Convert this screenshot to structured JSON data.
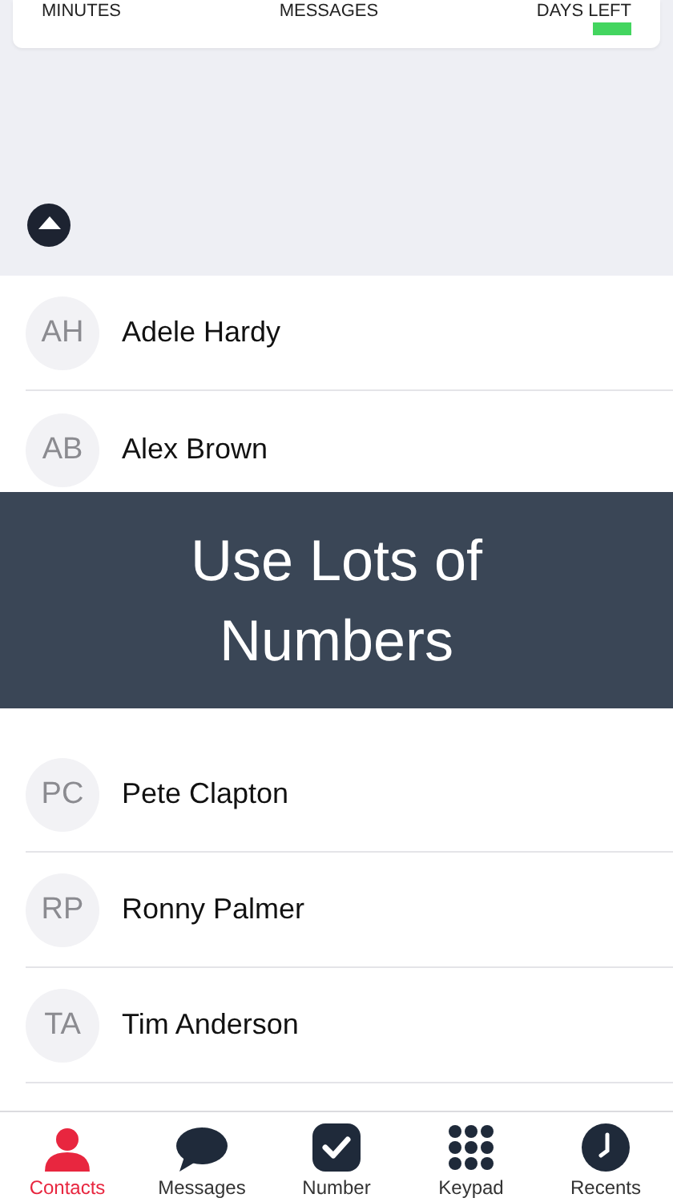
{
  "stats": [
    {
      "label": "MINUTES"
    },
    {
      "label": "MESSAGES"
    },
    {
      "label": "DAYS LEFT",
      "level": 1
    }
  ],
  "contacts": [
    {
      "initials": "AH",
      "name": "Adele Hardy"
    },
    {
      "initials": "AB",
      "name": "Alex Brown"
    },
    {
      "initials": "PC",
      "name": "Pete Clapton"
    },
    {
      "initials": "RP",
      "name": "Ronny Palmer"
    },
    {
      "initials": "TA",
      "name": "Tim Anderson"
    }
  ],
  "banner": {
    "lines": [
      "Use Lots of",
      "Numbers"
    ]
  },
  "tab_bar": [
    {
      "kind": "contacts",
      "label": "Contacts",
      "selected": true
    },
    {
      "kind": "messages",
      "label": "Messages",
      "selected": false
    },
    {
      "kind": "number",
      "label": "Number",
      "selected": false
    },
    {
      "kind": "keypad",
      "label": "Keypad",
      "selected": false
    },
    {
      "kind": "recents",
      "label": "Recents",
      "selected": false
    }
  ]
}
